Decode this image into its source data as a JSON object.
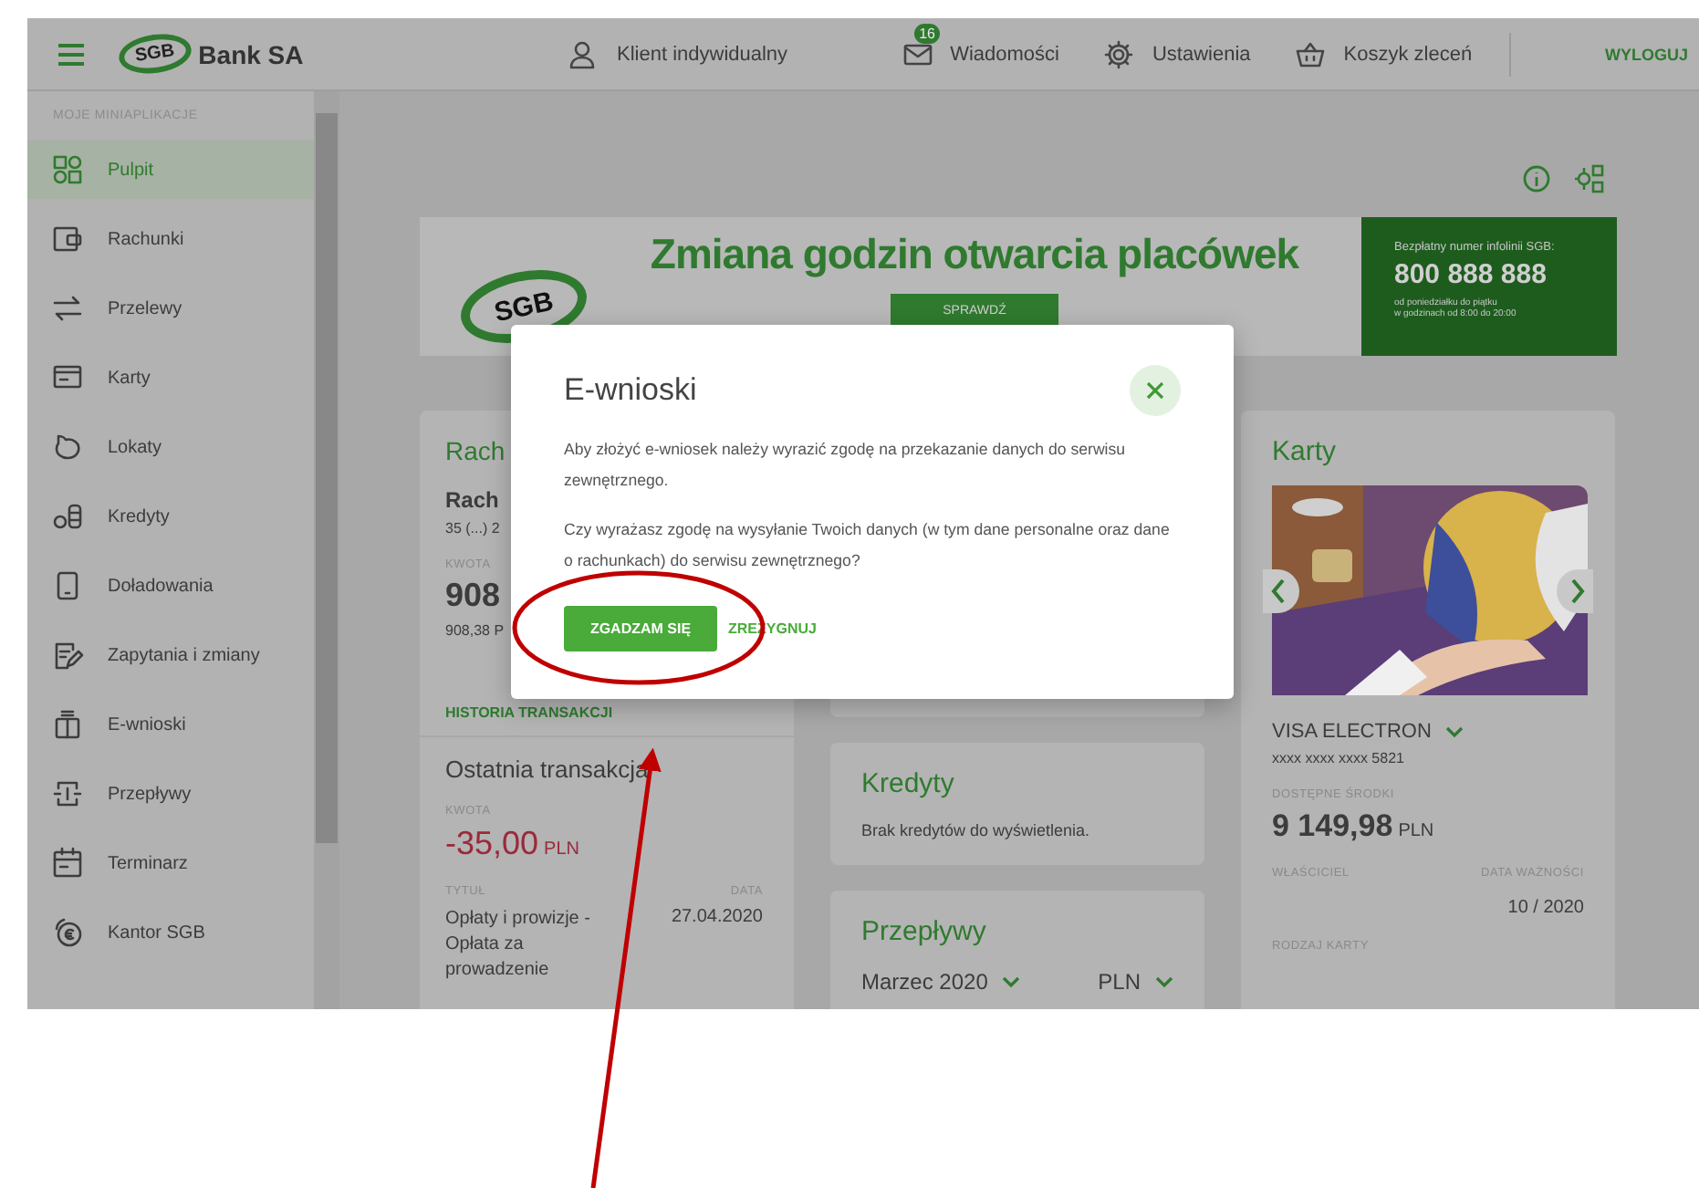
{
  "header": {
    "logo": "SGB",
    "brand": "Bank SA",
    "user": "Klient indywidualny",
    "nav": [
      {
        "kind": "mail",
        "label": "Wiadomości",
        "badge": "16"
      },
      {
        "kind": "gear",
        "label": "Ustawienia"
      },
      {
        "kind": "basket",
        "label": "Koszyk zleceń"
      }
    ],
    "logout": "WYLOGUJ"
  },
  "sidebar": {
    "heading": "MOJE MINIAPLIKACJE",
    "items": [
      {
        "kind": "dashboard",
        "label": "Pulpit",
        "selected": true
      },
      {
        "kind": "wallet",
        "label": "Rachunki",
        "selected": false
      },
      {
        "kind": "transfer",
        "label": "Przelewy",
        "selected": false
      },
      {
        "kind": "card",
        "label": "Karty",
        "selected": false
      },
      {
        "kind": "piggy",
        "label": "Lokaty",
        "selected": false
      },
      {
        "kind": "coins",
        "label": "Kredyty",
        "selected": false
      },
      {
        "kind": "phone",
        "label": "Doładowania",
        "selected": false
      },
      {
        "kind": "edit",
        "label": "Zapytania i zmiany",
        "selected": false
      },
      {
        "kind": "form",
        "label": "E-wnioski",
        "selected": false
      },
      {
        "kind": "flow",
        "label": "Przepływy",
        "selected": false
      },
      {
        "kind": "calendar",
        "label": "Terminarz",
        "selected": false
      },
      {
        "kind": "exchange",
        "label": "Kantor SGB",
        "selected": false
      }
    ]
  },
  "banner": {
    "logo": "SGB",
    "headline": "Zmiana godzin otwarcia placówek",
    "button": "SPRAWDŹ",
    "hotline": {
      "label": "Bezpłatny numer infolinii SGB:",
      "number": "800 888 888",
      "hours": [
        "od poniedziałku do piątku",
        "w godzinach od 8:00 do 20:00"
      ]
    }
  },
  "accounts": {
    "title": "Rach",
    "account_name": "Rach",
    "account_number": "35 (...) 2",
    "amount_label": "KWOTA",
    "amount": "908",
    "available": "908,38 P",
    "history_link": "HISTORIA TRANSAKCJI",
    "last_transaction": {
      "title": "Ostatnia transakcja",
      "amount_label": "KWOTA",
      "amount": "-35,00",
      "currency": "PLN",
      "title_label": "TYTUŁ",
      "date_label": "DATA",
      "description": "Opłaty i prowizje - Opłata za prowadzenie",
      "date": "27.04.2020"
    }
  },
  "loans": {
    "title": "Kredyty",
    "message": "Brak kredytów do wyświetlenia."
  },
  "cashflow": {
    "title": "Przepływy",
    "month": "Marzec 2020",
    "currency": "PLN"
  },
  "cards": {
    "title": "Karty",
    "name": "VISA ELECTRON",
    "number": "xxxx xxxx xxxx 5821",
    "funds_label": "DOSTĘPNE ŚRODKI",
    "funds": "9 149,98",
    "currency": "PLN",
    "owner_label": "WŁAŚCICIEL",
    "expiry_label": "DATA WAŻNOŚCI",
    "expiry": "10 / 2020",
    "type_label": "RODZAJ KARTY"
  },
  "dialog": {
    "title": "E-wnioski",
    "paragraphs": [
      "Aby złożyć e-wniosek należy wyrazić zgodę na przekazanie danych do serwisu zewnętrznego.",
      "Czy wyrażasz zgodę na wysyłanie Twoich danych (w tym dane personalne oraz dane o rachunkach) do serwisu zewnętrznego?"
    ],
    "buttons": [
      {
        "kind": "primary",
        "label": "ZGADZAM SIĘ"
      },
      {
        "kind": "link",
        "label": "ZREZYGNUJ"
      }
    ]
  }
}
